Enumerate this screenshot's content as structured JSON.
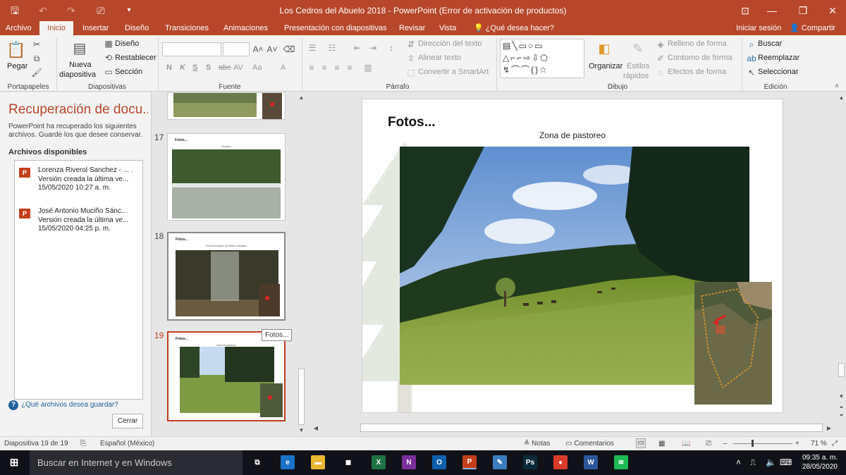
{
  "window": {
    "title": "Los Cedros del Abuelo 2018 - PowerPoint (Error de activación de productos)",
    "qat": {
      "save_icon": "save-icon",
      "undo_icon": "undo-icon",
      "redo_icon": "redo-icon",
      "present_icon": "present-icon",
      "customize_icon": "customize-icon"
    },
    "controls": {
      "ribbon_display_icon": "ribbon-display-icon",
      "minimize_icon": "minimize-icon",
      "restore_icon": "restore-icon",
      "close_icon": "close-icon"
    }
  },
  "tabs": [
    "Archivo",
    "Inicio",
    "Insertar",
    "Diseño",
    "Transiciones",
    "Animaciones",
    "Presentación con diapositivas",
    "Revisar",
    "Vista"
  ],
  "active_tab": "Inicio",
  "tell_me": "¿Qué desea hacer?",
  "account": {
    "signin": "Iniciar sesión",
    "share": "Compartir"
  },
  "ribbon": {
    "portapapeles": {
      "label": "Portapapeles",
      "paste": "Pegar"
    },
    "diapositivas": {
      "label": "Diapositivas",
      "new_slide_1": "Nueva",
      "new_slide_2": "diapositiva",
      "design": "Diseño",
      "reset": "Restablecer",
      "section": "Sección"
    },
    "fuente": {
      "label": "Fuente",
      "bold": "N",
      "italic": "K",
      "underline": "S",
      "shadow": "S",
      "strike": "abc",
      "spacing": "AV",
      "case": "Aa",
      "color": "A"
    },
    "parrafo": {
      "label": "Párrafo",
      "text_direction": "Dirección del texto",
      "align_text": "Alinear texto",
      "smartart": "Convertir a SmartArt"
    },
    "dibujo": {
      "label": "Dibujo",
      "arrange": "Organizar",
      "quick_styles_1": "Estilos",
      "quick_styles_2": "rápidos",
      "fill": "Relleno de forma",
      "outline": "Contorno de forma",
      "effects": "Efectos de forma"
    },
    "edicion": {
      "label": "Edición",
      "find": "Buscar",
      "replace": "Reemplazar",
      "select": "Seleccionar"
    }
  },
  "recovery": {
    "title": "Recuperación de docu...",
    "description": "PowerPoint ha recuperado los siguientes archivos. Guarde los que desee conservar.",
    "available_label": "Archivos disponibles",
    "files": [
      {
        "name": "Lorenza Riverol Sanchez - ... .",
        "version": "Versión creada la última ve...",
        "date": "15/05/2020 10:27 a. m."
      },
      {
        "name": "José Antonio Muciño Sánc...",
        "version": "Versión creada la última ve...",
        "date": "15/05/2020 04:25 p. m."
      }
    ],
    "help": "¿Qué archivos desea guardar?",
    "close": "Cerrar"
  },
  "thumbnails": [
    {
      "number": "17",
      "title": "Fotos...",
      "caption": "Picadero"
    },
    {
      "number": "18",
      "title": "Fotos...",
      "caption": "Zona de bosque, Senderos al Bosque"
    },
    {
      "number": "19",
      "title": "Fotos...",
      "caption": "Zona de pastoreo"
    }
  ],
  "tooltip": "Fotos...",
  "slide": {
    "title": "Fotos...",
    "caption": "Zona de pastoreo"
  },
  "status": {
    "slide_info": "Diapositiva 19 de 19",
    "language": "Español (México)",
    "notes": "Notas",
    "comments": "Comentarios",
    "zoom_minus": "–",
    "zoom_plus": "+",
    "zoom": "71 %",
    "zoom_level": 0.71
  },
  "taskbar": {
    "search": "Buscar en Internet y en Windows",
    "apps": [
      {
        "name": "task-view-icon",
        "label": "⧉",
        "color": "#101218"
      },
      {
        "name": "edge-icon",
        "label": "e",
        "color": "#1a73c8"
      },
      {
        "name": "file-explorer-icon",
        "label": "▬",
        "color": "#e8b630"
      },
      {
        "name": "store-icon",
        "label": "◼",
        "color": "#101218"
      },
      {
        "name": "excel-icon",
        "label": "X",
        "color": "#1f7244"
      },
      {
        "name": "onenote-icon",
        "label": "N",
        "color": "#7b2f9c"
      },
      {
        "name": "outlook-icon",
        "label": "O",
        "color": "#0f5fae"
      },
      {
        "name": "powerpoint-icon",
        "label": "P",
        "color": "#c43e1c"
      },
      {
        "name": "paint-icon",
        "label": "✎",
        "color": "#3b7dbf"
      },
      {
        "name": "photoshop-icon",
        "label": "Ps",
        "color": "#0b2a3a"
      },
      {
        "name": "chrome-icon",
        "label": "●",
        "color": "#d93b2b"
      },
      {
        "name": "word-icon",
        "label": "W",
        "color": "#2b579a"
      },
      {
        "name": "spotify-icon",
        "label": "≋",
        "color": "#1db954"
      }
    ],
    "time": "09:35 a. m.",
    "date": "28/05/2020"
  }
}
